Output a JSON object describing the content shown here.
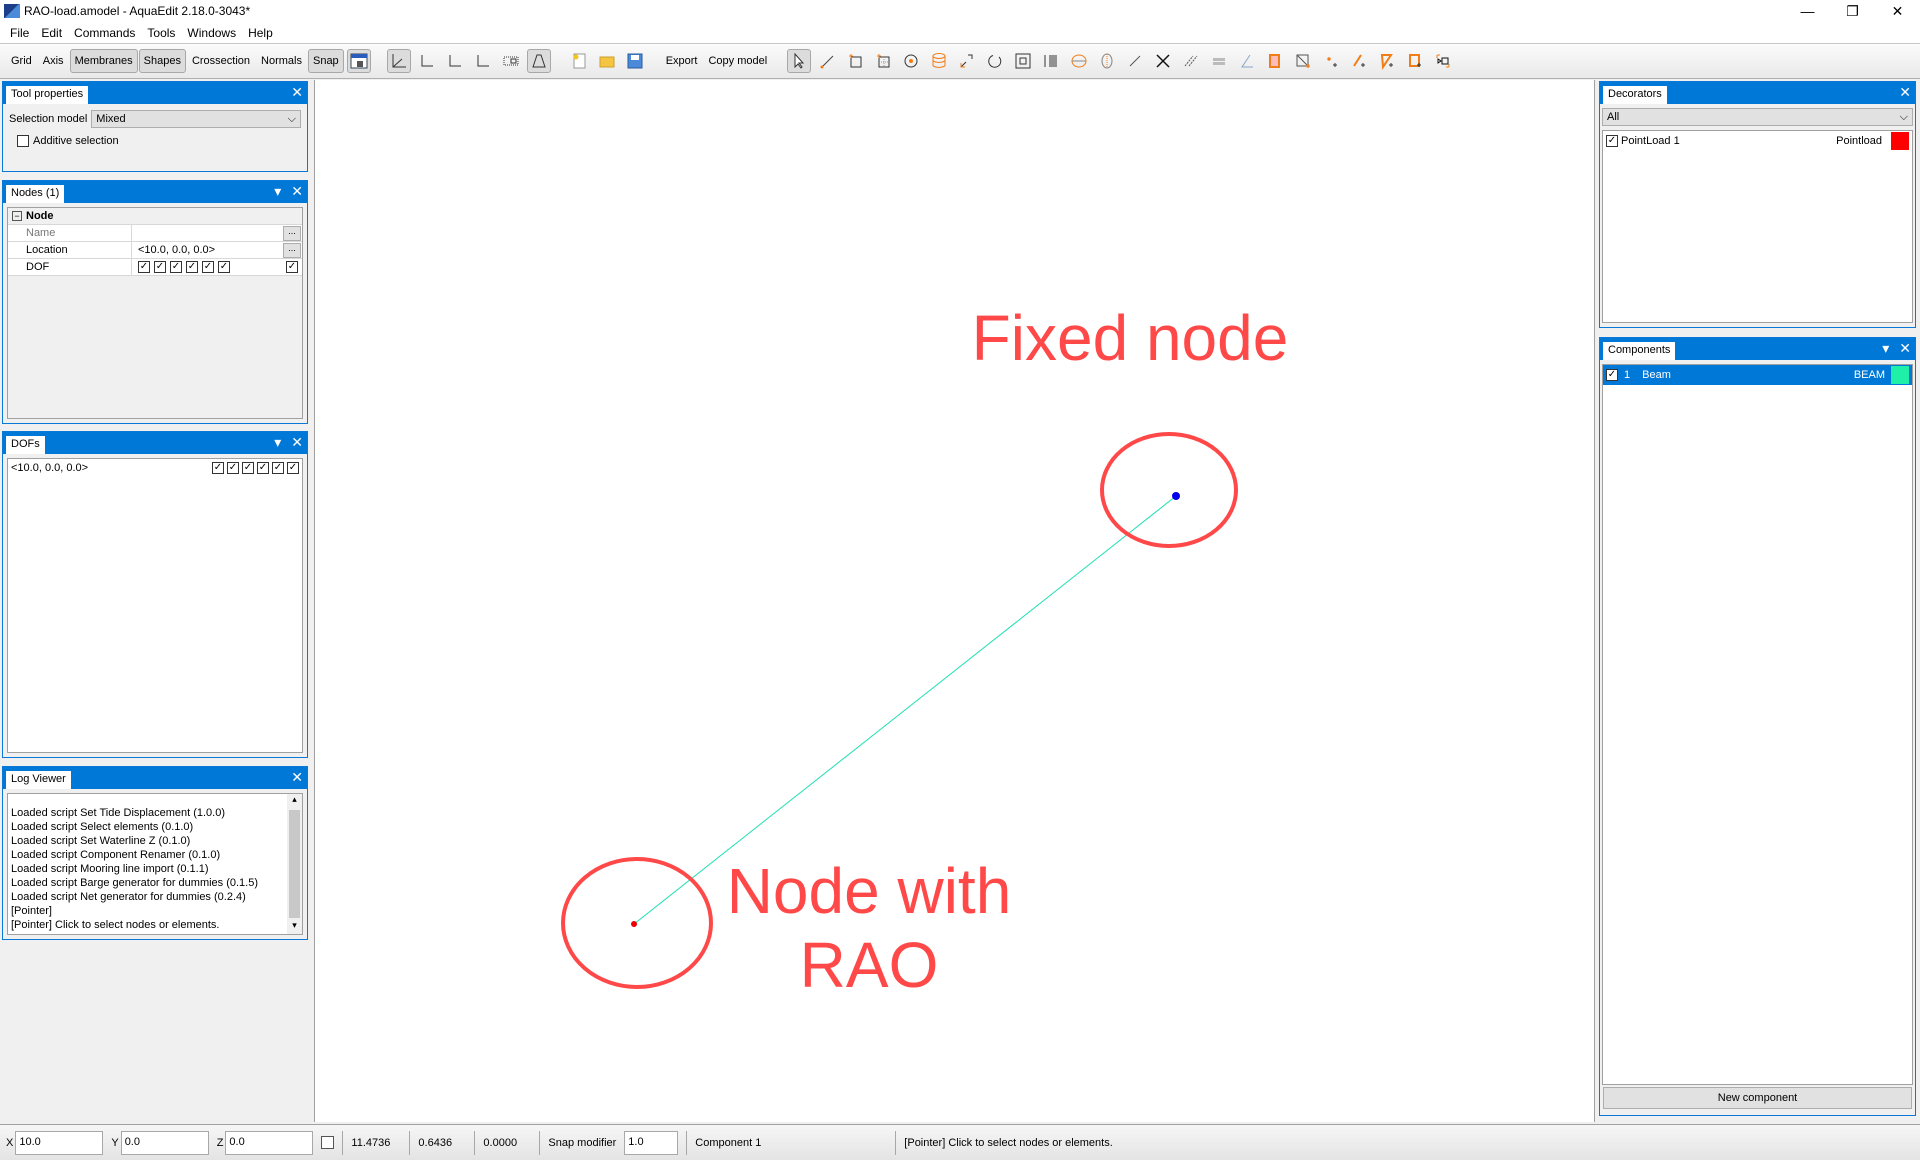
{
  "window": {
    "title": "RAO-load.amodel - AquaEdit 2.18.0-3043*",
    "controls": {
      "minimize": "—",
      "restore": "❐",
      "close": "✕"
    }
  },
  "menu": [
    "File",
    "Edit",
    "Commands",
    "Tools",
    "Windows",
    "Help"
  ],
  "toolbar": {
    "toggles": [
      {
        "label": "Grid",
        "active": false
      },
      {
        "label": "Axis",
        "active": false
      },
      {
        "label": "Membranes",
        "active": true
      },
      {
        "label": "Shapes",
        "active": true
      },
      {
        "label": "Crossection",
        "active": false
      },
      {
        "label": "Normals",
        "active": false
      },
      {
        "label": "Snap",
        "active": true
      }
    ],
    "export_label": "Export",
    "copy_model_label": "Copy model"
  },
  "tool_properties": {
    "title": "Tool properties",
    "selection_model_label": "Selection model",
    "selection_model_value": "Mixed",
    "additive_selection_label": "Additive selection",
    "additive_selection_checked": false
  },
  "nodes_panel": {
    "title": "Nodes (1)",
    "group": "Node",
    "rows": [
      {
        "key": "Name",
        "value": ""
      },
      {
        "key": "Location",
        "value": "<10.0, 0.0, 0.0>"
      },
      {
        "key": "DOF",
        "value": ""
      }
    ],
    "dof_checks": [
      true,
      true,
      true,
      true,
      true,
      true
    ],
    "dof_all": true
  },
  "dofs_panel": {
    "title": "DOFs",
    "items": [
      {
        "location": "<10.0, 0.0, 0.0>",
        "checks": [
          true,
          true,
          true,
          true,
          true,
          true
        ]
      }
    ]
  },
  "log_viewer": {
    "title": "Log Viewer",
    "lines": [
      "Loaded script Set Tide Displacement (1.0.0)",
      "Loaded script Select elements (0.1.0)",
      "Loaded script Set Waterline Z (0.1.0)",
      "Loaded script Component Renamer (0.1.0)",
      "Loaded script Mooring line import (0.1.1)",
      "Loaded script Barge generator for dummies (0.1.5)",
      "Loaded script Net generator for dummies (0.2.4)",
      "[Pointer]",
      "[Pointer] Click to select nodes or elements."
    ]
  },
  "decorators": {
    "title": "Decorators",
    "filter": "All",
    "items": [
      {
        "name": "PointLoad 1",
        "type": "Pointload",
        "checked": true,
        "color": "#ff0000"
      }
    ]
  },
  "components": {
    "title": "Components",
    "items": [
      {
        "index": "1",
        "name": "Beam",
        "type": "BEAM",
        "checked": true,
        "color": "#1ef0a8"
      }
    ],
    "new_button": "New component"
  },
  "canvas": {
    "annotation_fixed": "Fixed node",
    "annotation_rao_line1": "Node with",
    "annotation_rao_line2": "RAO",
    "annotation_color": "#ff4848",
    "beam_color": "#1ee0b0",
    "fixed_node_color": "#0000ee",
    "rao_node_color": "#ee0000"
  },
  "statusbar": {
    "x_label": "X",
    "x_value": "10.0",
    "y_label": "Y",
    "y_value": "0.0",
    "z_label": "Z",
    "z_value": "0.0",
    "readout1": "11.4736",
    "readout2": "0.6436",
    "readout3": "0.0000",
    "snap_modifier_label": "Snap modifier",
    "snap_modifier_value": "1.0",
    "component": "Component 1",
    "message": "[Pointer] Click to select nodes or elements."
  }
}
